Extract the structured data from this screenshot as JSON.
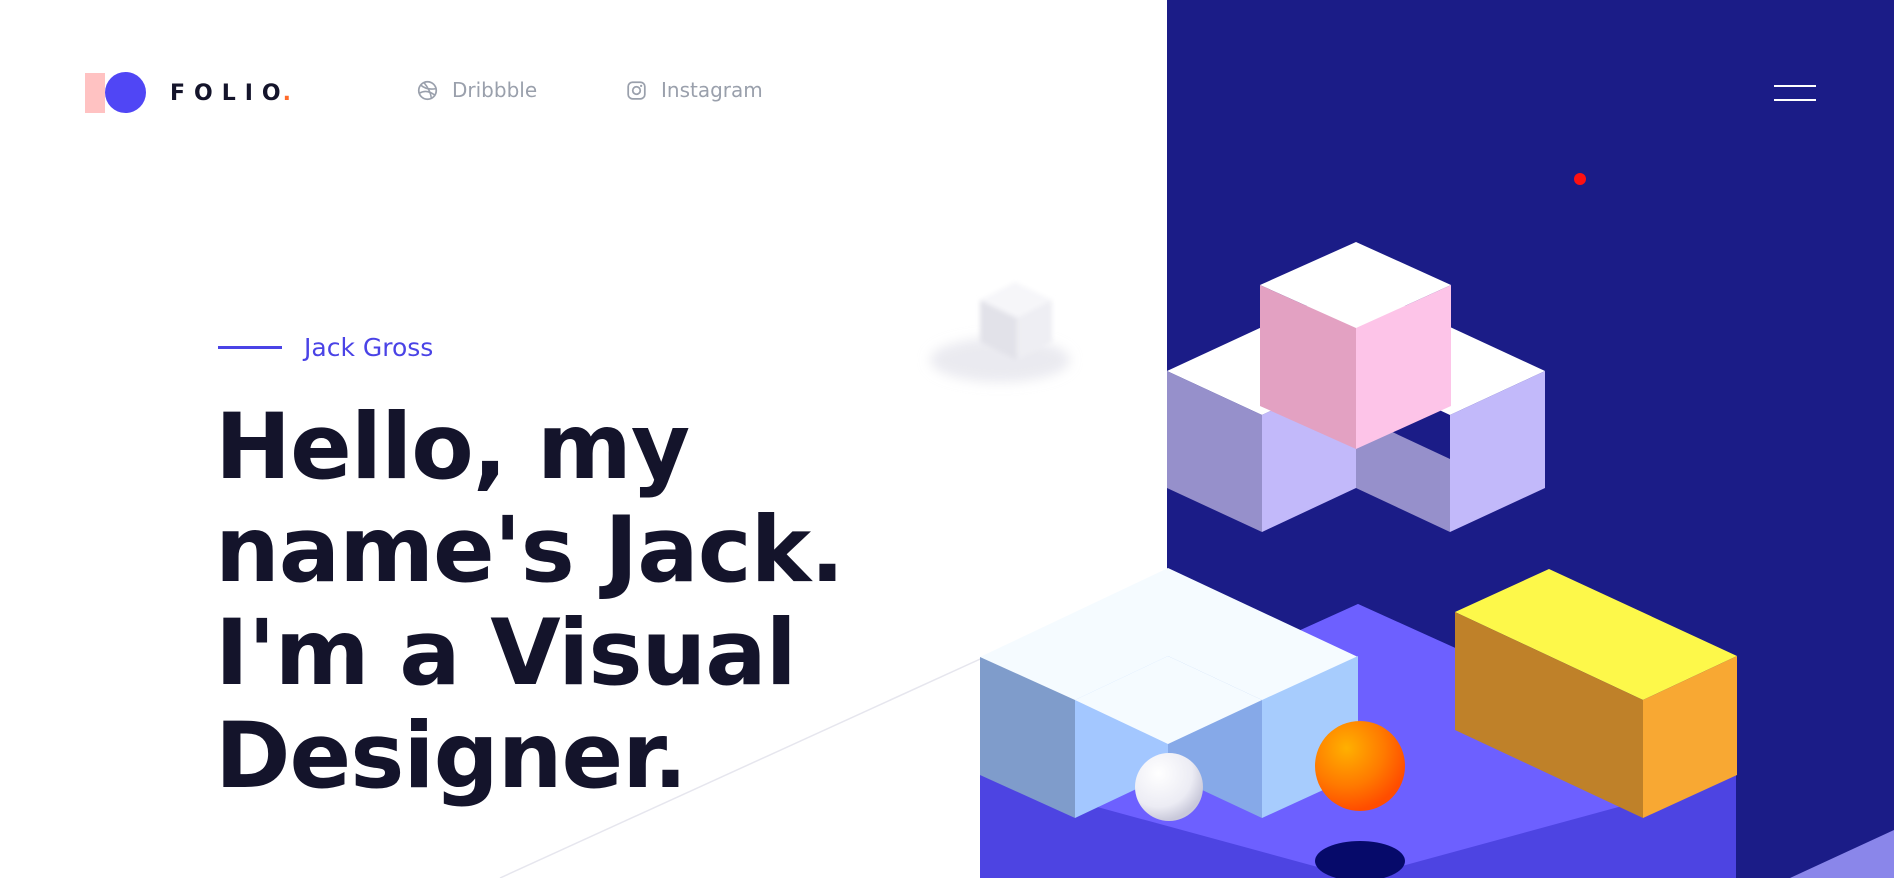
{
  "brand": {
    "name": "FOLIO",
    "dot": ".",
    "accent_color": "#ff6a2a"
  },
  "nav": {
    "dribbble": {
      "label": "Dribbble",
      "icon": "dribbble-icon"
    },
    "instagram": {
      "label": "Instagram",
      "icon": "instagram-icon"
    }
  },
  "menu": {
    "icon": "hamburger-menu-icon"
  },
  "hero": {
    "eyebrow": "Jack Gross",
    "headline": "Hello, my name's Jack. I'm a Visual Designer."
  },
  "colors": {
    "panel": "#1b1c87",
    "primary": "#4a43e6",
    "text": "#14142b",
    "muted": "#9aa0ac"
  }
}
